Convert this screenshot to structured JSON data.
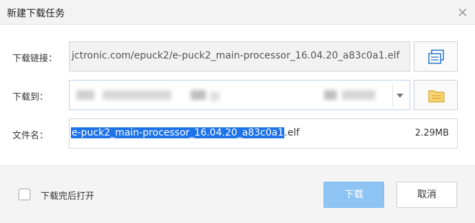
{
  "dialog": {
    "title": "新建下载任务"
  },
  "form": {
    "url_label": "下载链接：",
    "url_value": "jctronic.com/epuck2/e-puck2_main-processor_16.04.20_a83c0a1.elf",
    "save_to_label": "下载到：",
    "filename_label": "文件名：",
    "filename_selected": "e-puck2_main-processor_16.04.20_a83c0a1",
    "filename_ext": ".elf",
    "file_size": "2.29MB"
  },
  "footer": {
    "open_after_label": "下载完后打开",
    "open_after_checked": false,
    "download_button": "下载",
    "cancel_button": "取消"
  },
  "colors": {
    "selection": "#1e73e8",
    "primary_button": "#8ec4f3",
    "folder_icon": "#f2c14e",
    "link_icon": "#2b78c9"
  }
}
